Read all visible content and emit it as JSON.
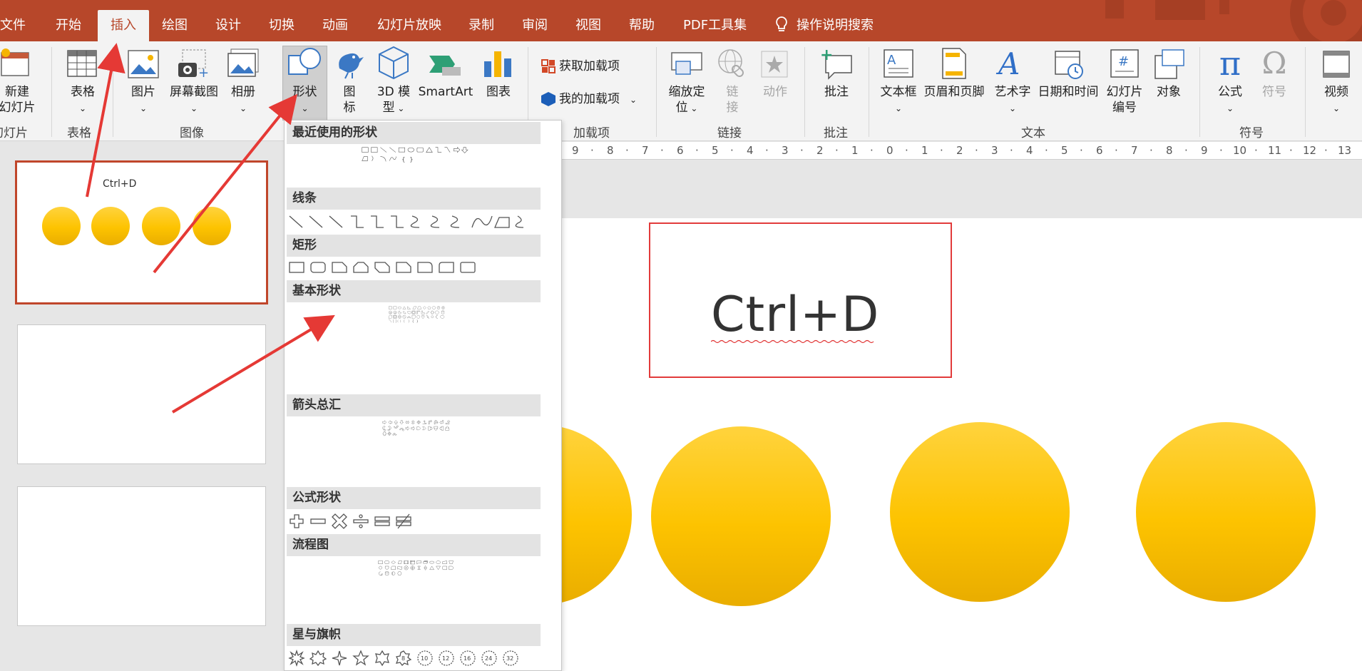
{
  "menu": {
    "tabs": [
      "文件",
      "开始",
      "插入",
      "绘图",
      "设计",
      "切换",
      "动画",
      "幻灯片放映",
      "录制",
      "审阅",
      "视图",
      "帮助",
      "PDF工具集"
    ],
    "active_tab": "插入",
    "search_label": "操作说明搜索"
  },
  "ribbon": {
    "new_slide": "新建\n幻灯片",
    "table": "表格",
    "picture": "图片",
    "screenshot": "屏幕截图",
    "album": "相册",
    "shapes": "形状",
    "icons": "图\n标",
    "model3d": "3D 模\n型",
    "smartart": "SmartArt",
    "chart": "图表",
    "get_addins": "获取加载项",
    "my_addins": "我的加载项",
    "zoom": "缩放定\n位",
    "link": "链\n接",
    "action": "动作",
    "comment": "批注",
    "textbox": "文本框",
    "header_footer": "页眉和页脚",
    "wordart": "艺术字",
    "datetime": "日期和时间",
    "slide_number": "幻灯片\n编号",
    "object": "对象",
    "equation": "公式",
    "symbol": "符号",
    "video": "视频",
    "groups": {
      "slides": "幻灯片",
      "tables": "表格",
      "images": "图像",
      "addins": "加载项",
      "links": "链接",
      "comments": "批注",
      "text": "文本",
      "symbols": "符号"
    }
  },
  "ruler": {
    "ticks": [
      "9",
      "8",
      "7",
      "6",
      "5",
      "4",
      "3",
      "2",
      "1",
      "0",
      "1",
      "2",
      "3",
      "4",
      "5",
      "6",
      "7",
      "8",
      "9",
      "10",
      "11",
      "12",
      "13"
    ]
  },
  "slide": {
    "text": "Ctrl+D"
  },
  "thumbnail": {
    "text": "Ctrl+D"
  },
  "shapes_menu": {
    "sections": [
      "最近使用的形状",
      "线条",
      "矩形",
      "基本形状",
      "箭头总汇",
      "公式形状",
      "流程图",
      "星与旗帜"
    ],
    "star_labels": [
      "8",
      "10",
      "12",
      "16",
      "24",
      "32"
    ]
  },
  "colors": {
    "accent": "#b7472a",
    "circle": "#fdc300",
    "highlight_box": "#e23b3b",
    "arrow": "#e53935"
  }
}
